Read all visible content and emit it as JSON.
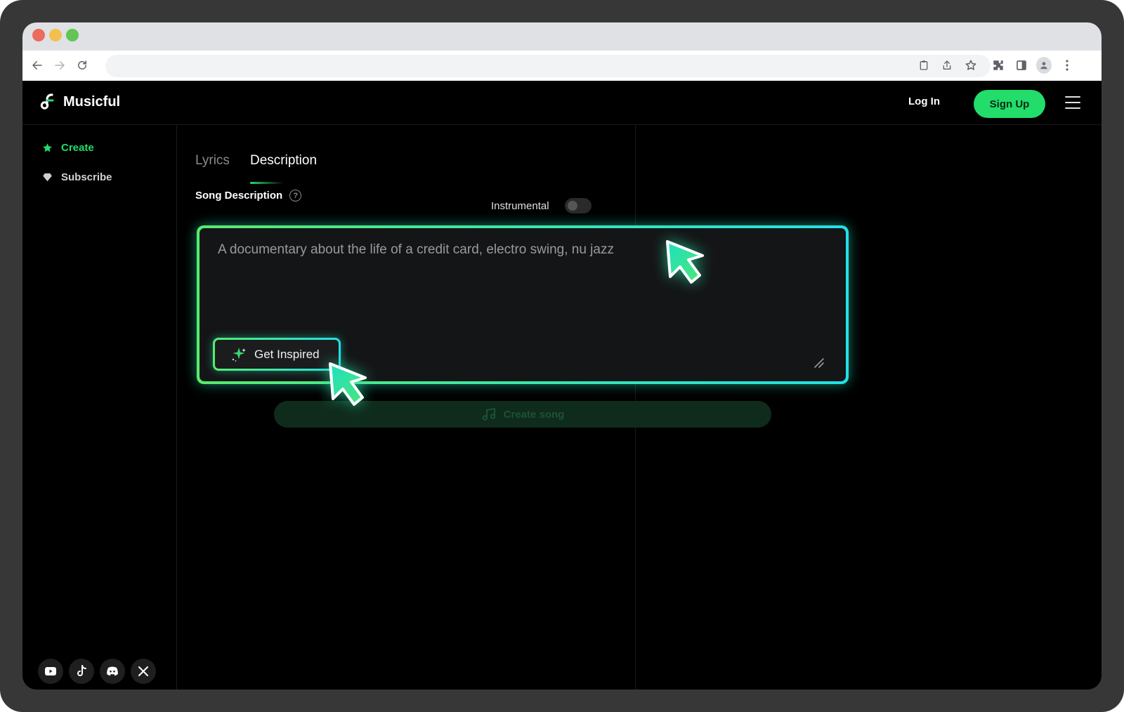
{
  "browser": {
    "traffic_lights": [
      "close",
      "minimize",
      "maximize"
    ],
    "nav_icons": [
      "back-icon",
      "forward-icon",
      "reload-icon"
    ],
    "toolbar_icons": [
      "clipboard-icon",
      "share-icon",
      "star-icon",
      "extensions-icon",
      "sidepanel-icon",
      "profile-icon",
      "more-icon"
    ]
  },
  "header": {
    "logo_text": "Musicful",
    "login_label": "Log In",
    "signup_label": "Sign Up",
    "accent_color": "#22dd6a"
  },
  "sidebar": {
    "items": [
      {
        "label": "Create",
        "icon": "star-icon",
        "active": true
      },
      {
        "label": "Subscribe",
        "icon": "diamond-icon",
        "active": false
      }
    ],
    "social": [
      "youtube-icon",
      "tiktok-icon",
      "discord-icon",
      "x-icon"
    ]
  },
  "main": {
    "tabs": [
      {
        "label": "Lyrics",
        "active": false
      },
      {
        "label": "Description",
        "active": true
      }
    ],
    "song_description_label": "Song Description",
    "instrumental_label": "Instrumental",
    "instrumental_on": false,
    "description_placeholder": "A documentary about the life of a credit card, electro swing, nu jazz",
    "get_inspired_label": "Get Inspired",
    "create_song_label": "Create song"
  }
}
